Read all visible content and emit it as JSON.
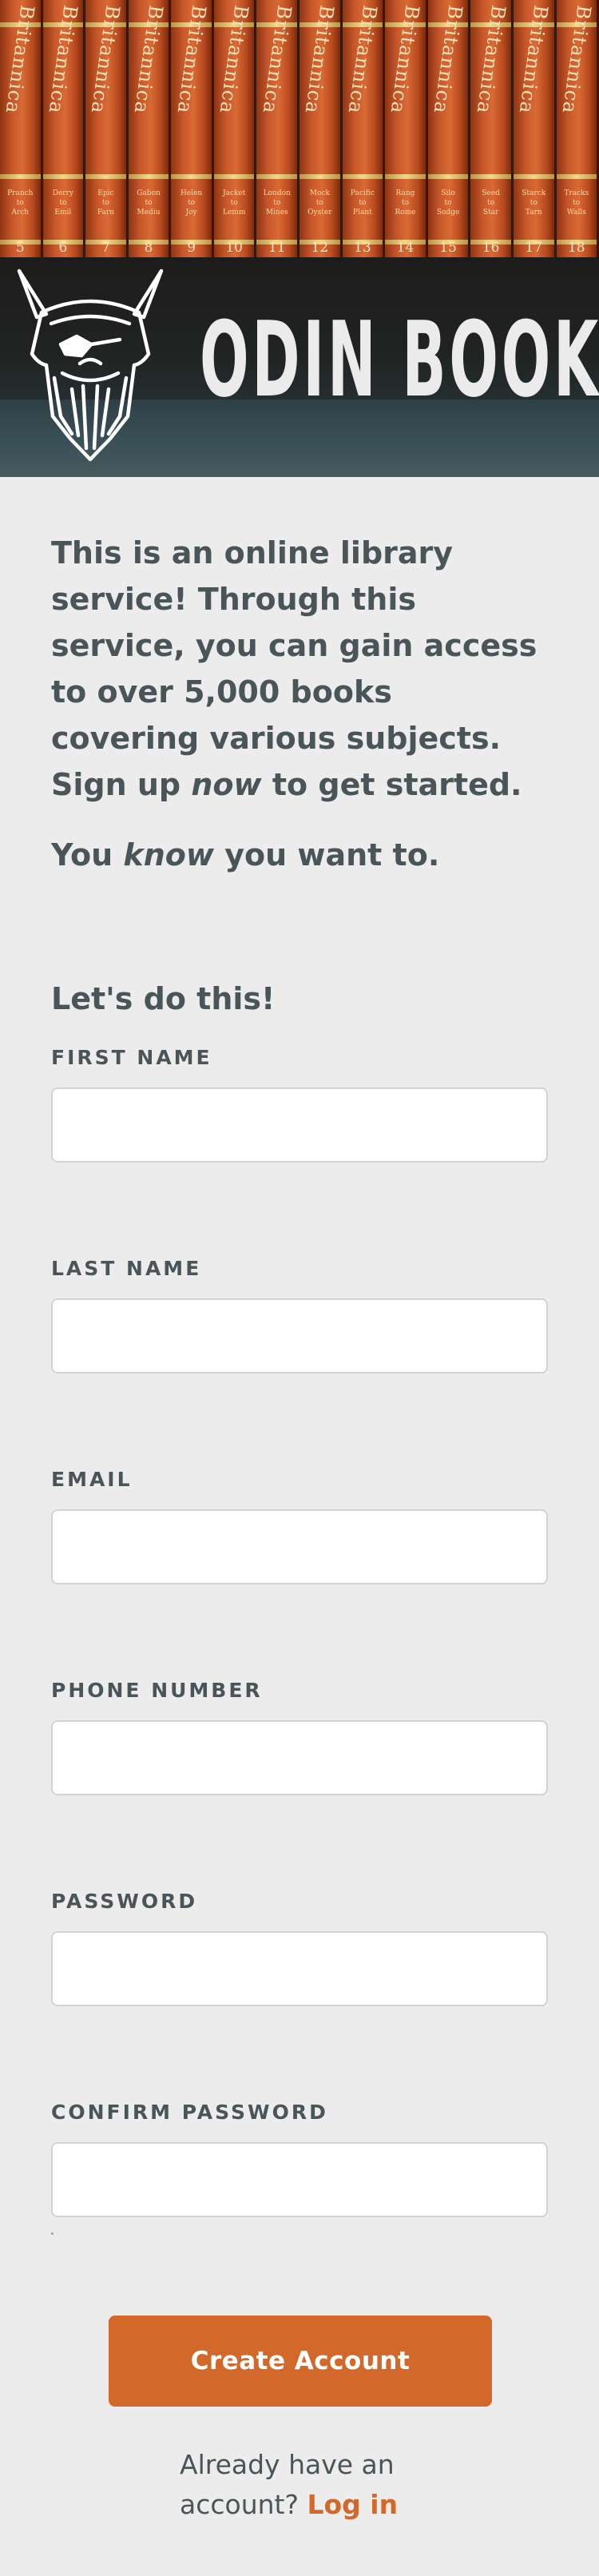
{
  "hero": {
    "brand_name": "ODIN BOOKS",
    "spine_title": "Britannica",
    "volumes": [
      {
        "number": "5",
        "sub": "Pranch\nto\nArch"
      },
      {
        "number": "6",
        "sub": "Derry\nto\nEmil"
      },
      {
        "number": "7",
        "sub": "Epic\nto\nFarn"
      },
      {
        "number": "8",
        "sub": "Gabon\nto\nMediu"
      },
      {
        "number": "9",
        "sub": "Helen\nto\nJoy"
      },
      {
        "number": "10",
        "sub": "Jacket\nto\nLemm"
      },
      {
        "number": "11",
        "sub": "London\nto\nMines"
      },
      {
        "number": "12",
        "sub": "Mock\nto\nOyster"
      },
      {
        "number": "13",
        "sub": "Pacific\nto\nPlant"
      },
      {
        "number": "14",
        "sub": "Rang\nto\nRome"
      },
      {
        "number": "15",
        "sub": "Silo\nto\nSodge"
      },
      {
        "number": "16",
        "sub": "Seed\nto\nStar"
      },
      {
        "number": "17",
        "sub": "Starck\nto\nTarn"
      },
      {
        "number": "18",
        "sub": "Tracks\nto\nWalls"
      }
    ]
  },
  "intro": {
    "line1": "This is an online library service! Through this service, you can gain access to over 5,000 books covering various subjects.",
    "signup_prefix": "Sign up ",
    "signup_em": "now",
    "signup_suffix": " to get started.",
    "tag_prefix": "You ",
    "tag_em": "know",
    "tag_suffix": " you want to."
  },
  "form": {
    "heading": "Let's do this!",
    "fields": [
      {
        "label": "FIRST NAME",
        "value": "",
        "placeholder": ""
      },
      {
        "label": "LAST NAME",
        "value": "",
        "placeholder": ""
      },
      {
        "label": "EMAIL",
        "value": "",
        "placeholder": ""
      },
      {
        "label": "PHONE NUMBER",
        "value": "",
        "placeholder": ""
      },
      {
        "label": "PASSWORD",
        "value": "",
        "placeholder": ""
      },
      {
        "label": "CONFIRM PASSWORD",
        "value": "",
        "placeholder": ""
      }
    ],
    "submit_label": "Create Account",
    "login_prompt": "Already have an account?",
    "login_link": "Log in"
  },
  "colors": {
    "accent": "#d2692a",
    "text": "#4a5559",
    "background": "#ececec",
    "input_border": "#d2d2d2"
  }
}
